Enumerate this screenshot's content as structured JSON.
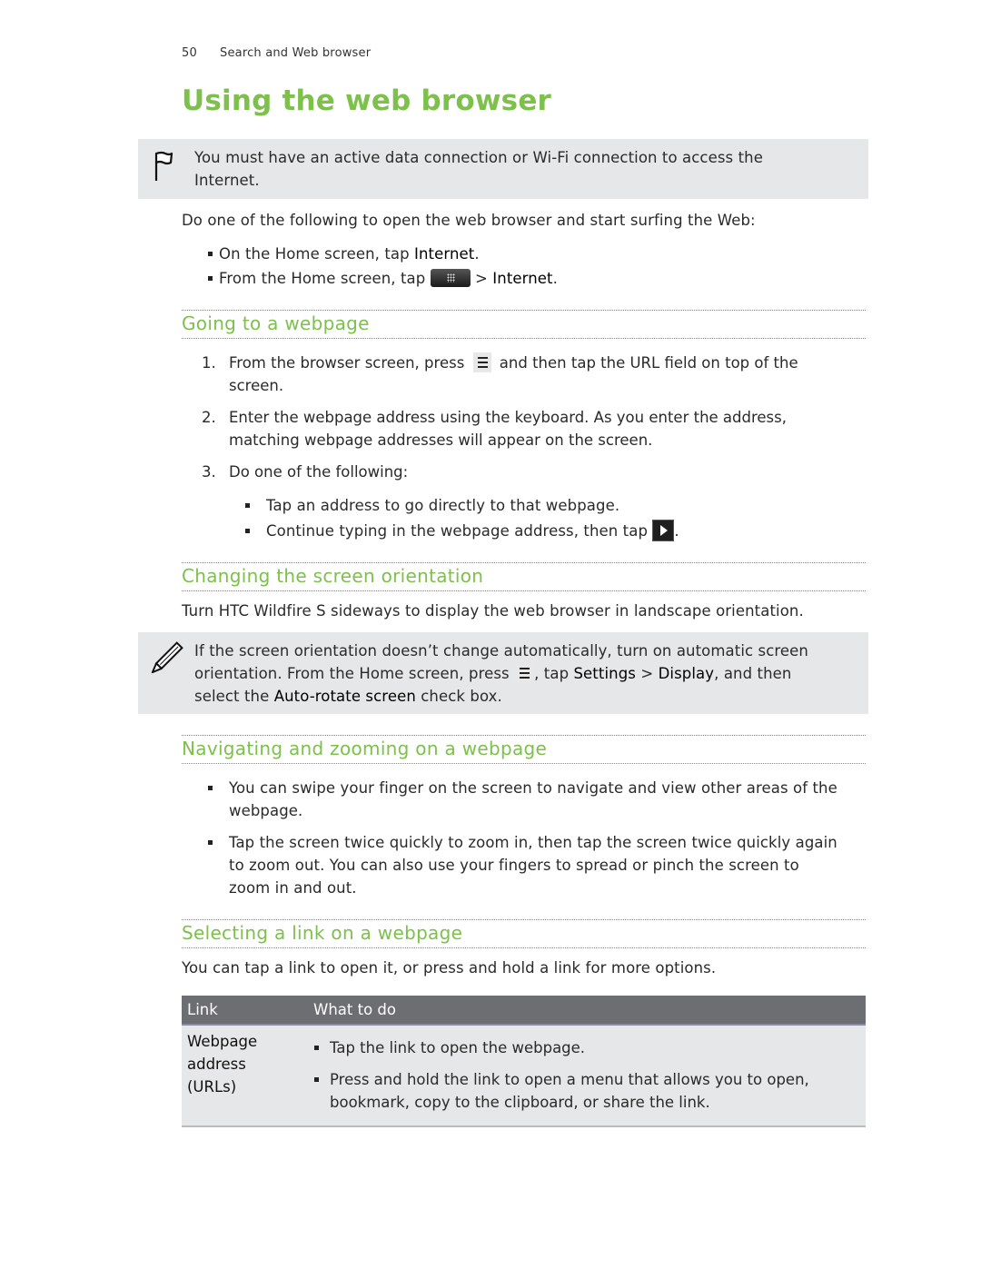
{
  "header": {
    "page_number": "50",
    "chapter": "Search and Web browser"
  },
  "title": "Using the web browser",
  "note1": {
    "icon": "flag-icon",
    "text": "You must have an active data connection or Wi-Fi connection to access the Internet."
  },
  "intro": {
    "text": "Do one of the following to open the web browser and start surfing the Web:",
    "bullets": [
      {
        "before": "On the Home screen, tap ",
        "bold": "Internet",
        "after": "."
      },
      {
        "before": "From the Home screen, tap ",
        "icon": "all-apps-icon",
        "middle": " > ",
        "bold": "Internet",
        "after": "."
      }
    ]
  },
  "sections": {
    "going": {
      "heading": "Going to a webpage",
      "steps": [
        {
          "num": "1.",
          "before": "From the browser screen, press ",
          "icon": "menu-icon",
          "after_line1": " and then tap the URL field on top of the",
          "line2": "screen."
        },
        {
          "num": "2.",
          "line1": "Enter the webpage address using the keyboard. As you enter the address,",
          "line2": "matching webpage addresses will appear on the screen."
        },
        {
          "num": "3.",
          "line1": "Do one of the following:"
        }
      ],
      "sub_bullets": [
        {
          "text": "Tap an address to go directly to that webpage."
        },
        {
          "before": "Continue typing in the webpage address, then tap ",
          "icon": "go-arrow-icon",
          "after": "."
        }
      ]
    },
    "orientation": {
      "heading": "Changing the screen orientation",
      "text": "Turn HTC Wildfire S sideways to display the web browser in landscape orientation.",
      "note": {
        "icon": "pencil-icon",
        "line1": "If the screen orientation doesn’t change automatically, turn on automatic screen",
        "line2_before": "orientation. From the Home screen, press ",
        "line2_icon": "menu-icon",
        "line2_mid1": ", tap ",
        "line2_bold1": "Settings",
        "line2_mid2": " > ",
        "line2_bold2": "Display",
        "line2_after": ", and then",
        "line3_before": "select the ",
        "line3_bold": "Auto-rotate screen",
        "line3_after": " check box."
      }
    },
    "navigating": {
      "heading": "Navigating and zooming on a webpage",
      "bullets": [
        {
          "line1": "You can swipe your finger on the screen to navigate and view other areas of the",
          "line2": "webpage."
        },
        {
          "line1": "Tap the screen twice quickly to zoom in, then tap the screen twice quickly again",
          "line2": "to zoom out. You can also use your fingers to spread or pinch the screen to",
          "line3": "zoom in and out."
        }
      ]
    },
    "selecting": {
      "heading": "Selecting a link on a webpage",
      "text": "You can tap a link to open it, or press and hold a link for more options.",
      "table": {
        "columns": [
          "Link",
          "What to do"
        ],
        "rows": [
          {
            "link_lines": [
              "Webpage",
              "address",
              "(URLs)"
            ],
            "actions": [
              {
                "line1": "Tap the link to open the webpage."
              },
              {
                "line1": "Press and hold the link to open a menu that allows you to open,",
                "line2": "bookmark, copy to the clipboard, or share the link."
              }
            ]
          }
        ]
      }
    }
  },
  "colors": {
    "accent_green": "#7dc04b",
    "note_bg": "#e6e7e8",
    "table_header_bg": "#6d6e71"
  }
}
